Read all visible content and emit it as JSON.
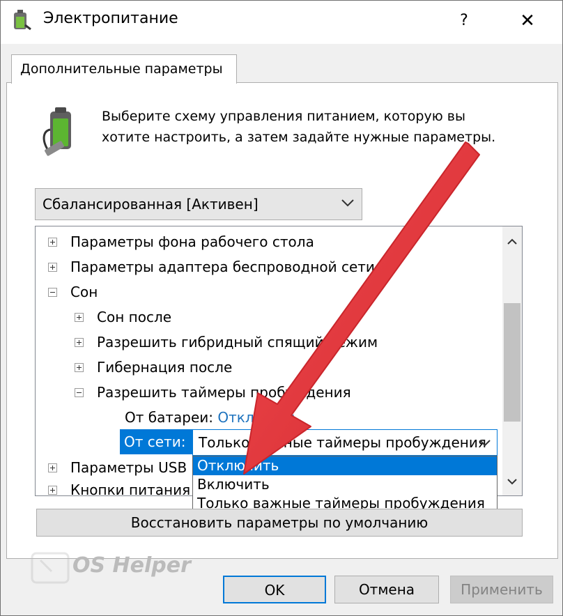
{
  "window": {
    "title": "Электропитание",
    "help_label": "?",
    "close_label": "✕"
  },
  "tab": {
    "label": "Дополнительные параметры"
  },
  "description": {
    "line1": "Выберите схему управления питанием, которую вы",
    "line2": "хотите настроить, а затем задайте нужные параметры."
  },
  "scheme_select": {
    "value": "Сбалансированная [Активен]"
  },
  "tree": {
    "items": [
      {
        "label": "Параметры фона рабочего стола",
        "expander": "+"
      },
      {
        "label": "Параметры адаптера беспроводной сети",
        "expander": "+"
      },
      {
        "label": "Сон",
        "expander": "−"
      },
      {
        "label": "Сон после",
        "expander": "+"
      },
      {
        "label": "Разрешить гибридный спящий режим",
        "expander": "+"
      },
      {
        "label": "Гибернация после",
        "expander": "+"
      },
      {
        "label": "Разрешить таймеры пробуждения",
        "expander": "−"
      },
      {
        "label": "Параметры USB",
        "expander": "+"
      },
      {
        "label": "Кнопки питания и крышка",
        "expander": "+"
      }
    ],
    "battery": {
      "label": "От батареи:",
      "value": "Отключить"
    },
    "ac": {
      "label": "От сети:",
      "value": "Только важные таймеры пробуждения"
    }
  },
  "dropdown": {
    "options": [
      "Отключить",
      "Включить",
      "Только важные таймеры пробуждения"
    ],
    "selected_index": 0
  },
  "buttons": {
    "restore": "Восстановить параметры по умолчанию",
    "ok": "OK",
    "cancel": "Отмена",
    "apply": "Применить"
  },
  "watermark": {
    "text": "OS Helper"
  },
  "colors": {
    "accent": "#0078d7",
    "link": "#1e73be",
    "arrow": "#e8383d"
  },
  "icons": {
    "app": "power-plug-icon",
    "battery": "battery-plug-icon",
    "chevron": "chevron-down-icon",
    "scroll_up": "chevron-up-icon",
    "scroll_down": "chevron-down-icon"
  }
}
